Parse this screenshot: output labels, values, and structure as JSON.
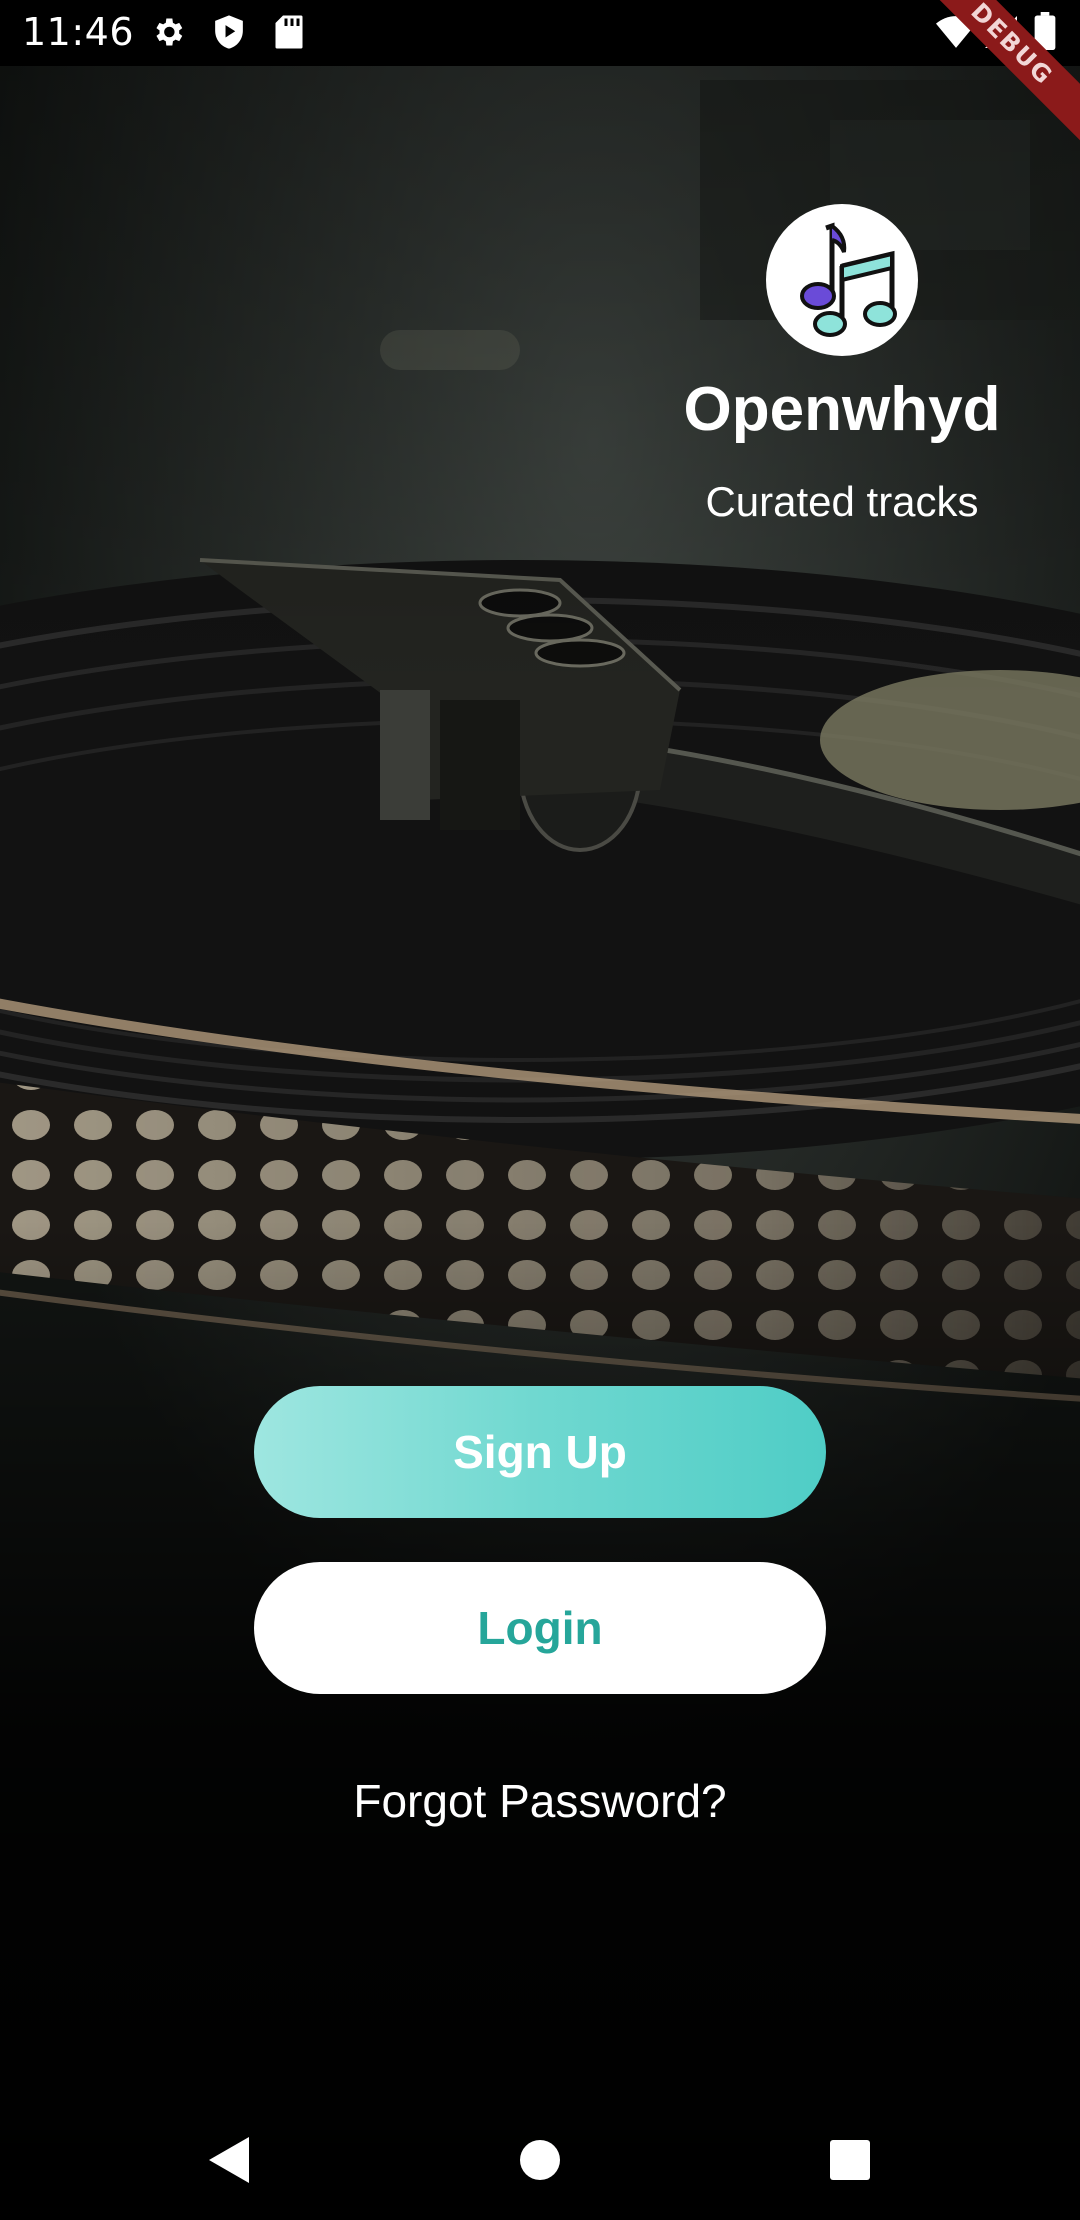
{
  "status_bar": {
    "time": "11:46",
    "left_icons": [
      "settings-icon",
      "shield-play-icon",
      "sd-card-icon"
    ],
    "right_icons": [
      "wifi-icon",
      "cell-signal-icon",
      "battery-icon"
    ]
  },
  "debug_banner": {
    "label": "DEBUG",
    "color": "#8b1a1a"
  },
  "brand": {
    "logo_icon": "music-notes-icon",
    "name": "Openwhyd",
    "tagline": "Curated tracks"
  },
  "actions": {
    "signup_label": "Sign Up",
    "login_label": "Login",
    "forgot_label": "Forgot Password?"
  },
  "colors": {
    "signup_gradient_start": "#9ee6e0",
    "signup_gradient_end": "#4fcdc6",
    "login_text": "#26a69a",
    "logo_note_purple": "#6a4bd8",
    "logo_note_teal": "#8ee3da"
  },
  "nav_bar": {
    "icons": [
      "back-icon",
      "home-icon",
      "recents-icon"
    ]
  }
}
